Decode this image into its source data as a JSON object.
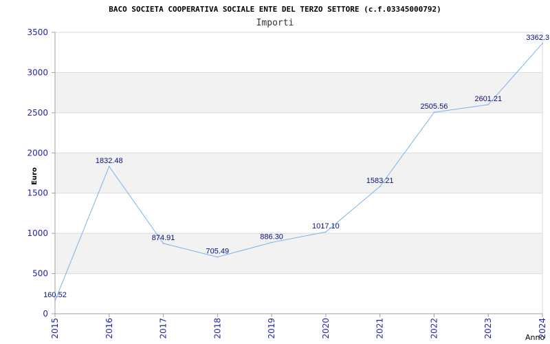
{
  "chart_data": {
    "type": "line",
    "title": "BACO SOCIETA COOPERATIVA SOCIALE ENTE DEL TERZO SETTORE (c.f.03345000792)",
    "subtitle": "Importi",
    "xlabel": "Anno",
    "ylabel": "Euro",
    "x": [
      "2015",
      "2016",
      "2017",
      "2018",
      "2019",
      "2020",
      "2021",
      "2022",
      "2023",
      "2024"
    ],
    "series": [
      {
        "values": [
          160.52,
          1832.48,
          874.91,
          705.49,
          886.3,
          1017.1,
          1583.21,
          2505.56,
          2601.21,
          3362.3
        ],
        "labels": [
          "160.52",
          "1832.48",
          "874.91",
          "705.49",
          "886.30",
          "1017.10",
          "1583.21",
          "2505.56",
          "2601.21",
          "3362.3"
        ]
      }
    ],
    "ylim": [
      0,
      3500
    ],
    "yticks": [
      0,
      500,
      1000,
      1500,
      2000,
      2500,
      3000,
      3500
    ],
    "grid": true,
    "alternating_bands": true,
    "colors": {
      "line": "#7ab2e8",
      "axis_text": "#2323a6",
      "data_label": "#0b0b80",
      "band": "#f2f2f2",
      "grid": "#dadada",
      "axis": "#a0a0a0"
    }
  }
}
